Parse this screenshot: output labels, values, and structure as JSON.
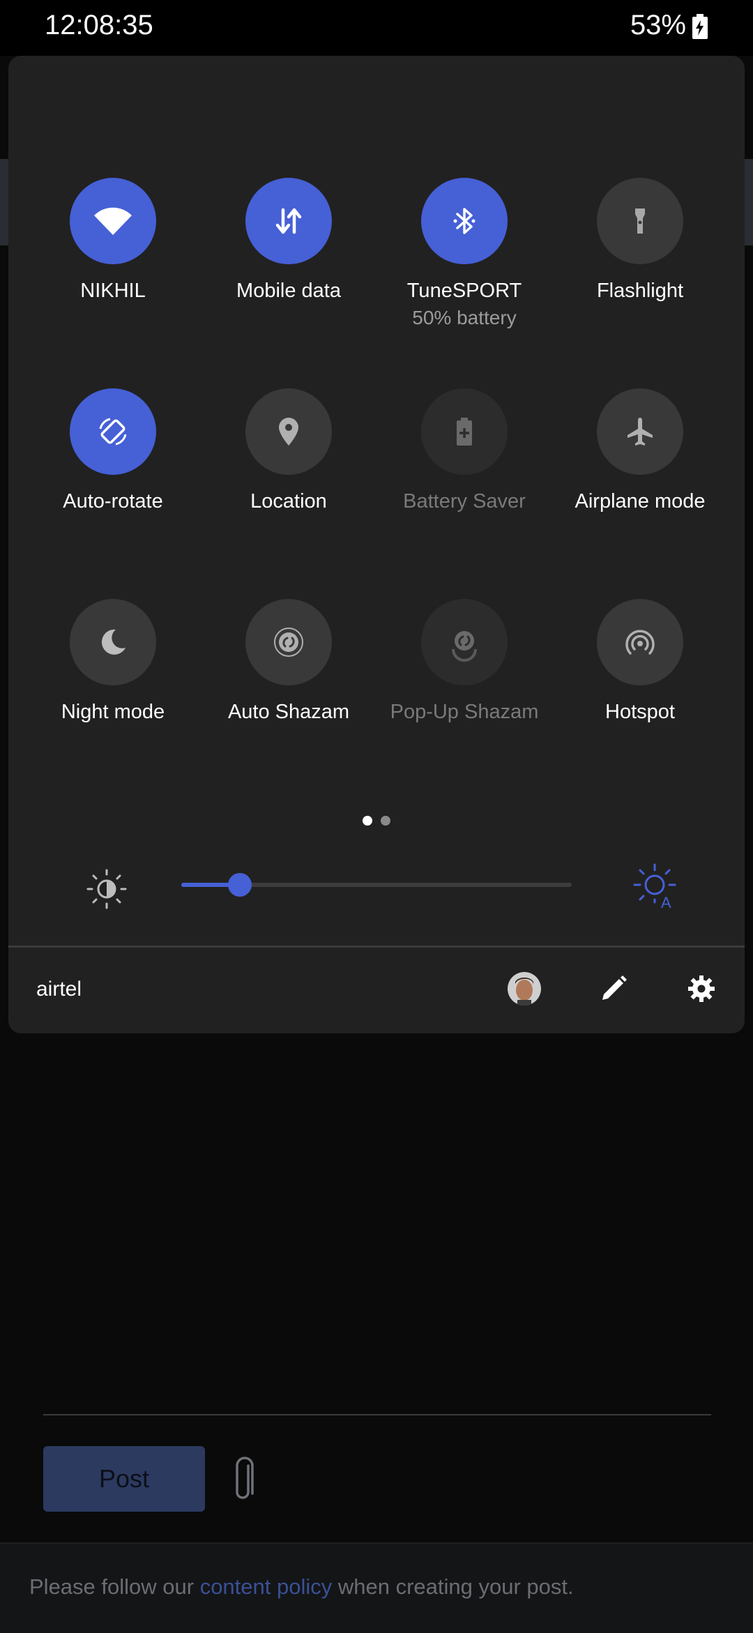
{
  "status_bar": {
    "time": "12:08:35",
    "battery_percent": "53%"
  },
  "quick_settings": {
    "tiles": [
      {
        "label": "NIKHIL",
        "icon": "wifi-icon",
        "state": "on"
      },
      {
        "label": "Mobile data",
        "icon": "mobile-data-icon",
        "state": "on"
      },
      {
        "label": "TuneSPORT",
        "sublabel": "50% battery",
        "icon": "bluetooth-icon",
        "state": "on"
      },
      {
        "label": "Flashlight",
        "icon": "flashlight-icon",
        "state": "off"
      },
      {
        "label": "Auto-rotate",
        "icon": "auto-rotate-icon",
        "state": "on"
      },
      {
        "label": "Location",
        "icon": "location-icon",
        "state": "off"
      },
      {
        "label": "Battery Saver",
        "icon": "battery-saver-icon",
        "state": "disabled"
      },
      {
        "label": "Airplane mode",
        "icon": "airplane-icon",
        "state": "off"
      },
      {
        "label": "Night mode",
        "icon": "moon-icon",
        "state": "off"
      },
      {
        "label": "Auto Shazam",
        "icon": "shazam-icon",
        "state": "off"
      },
      {
        "label": "Pop-Up Shazam",
        "icon": "shazam-popup-icon",
        "state": "disabled"
      },
      {
        "label": "Hotspot",
        "icon": "hotspot-icon",
        "state": "off"
      }
    ],
    "page_indicator": {
      "current": 1,
      "total": 2
    },
    "brightness": {
      "level": 0.15,
      "auto": true
    },
    "carrier": "airtel",
    "accent_color": "#4660d6"
  },
  "background_app": {
    "post_button": "Post",
    "footer": {
      "prefix": "Please follow our ",
      "link": "content policy",
      "suffix": " when creating your post."
    }
  }
}
